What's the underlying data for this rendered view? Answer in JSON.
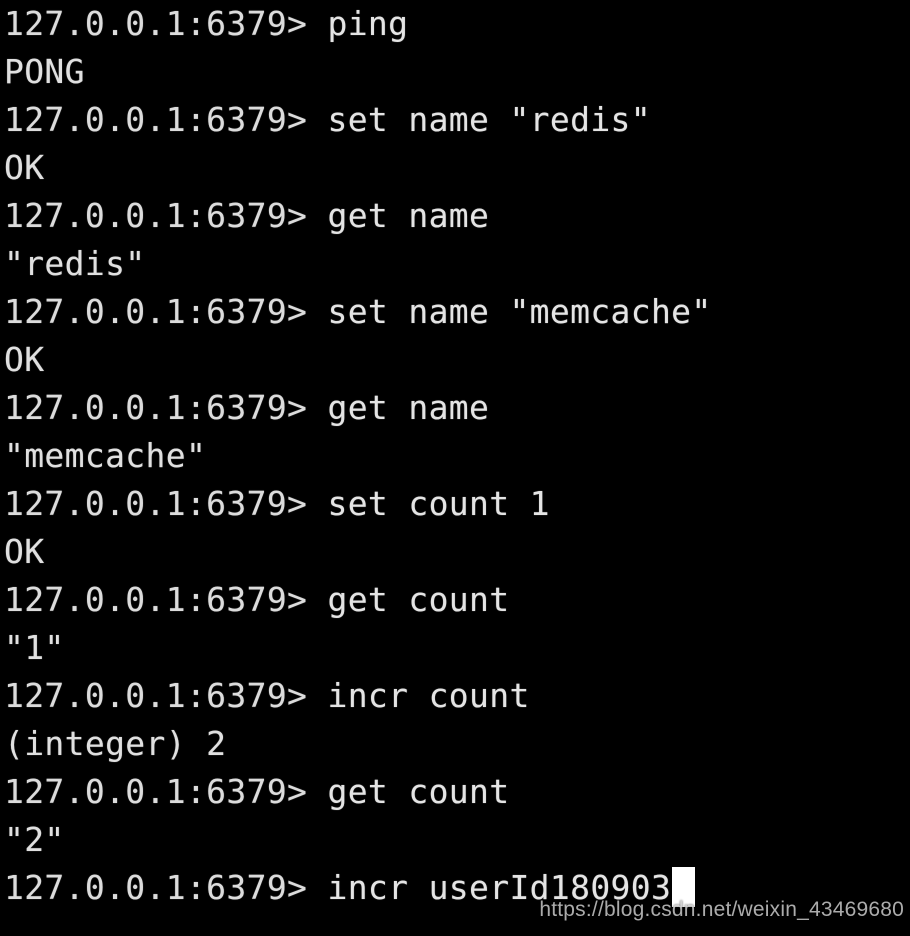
{
  "terminal": {
    "background_color": "#000000",
    "text_color": "#dcdcdc",
    "cursor_color": "#ffffff",
    "prompt": "127.0.0.1:6379>",
    "lines": [
      {
        "type": "command",
        "prompt": "127.0.0.1:6379>",
        "command": " ping"
      },
      {
        "type": "output",
        "text": "PONG"
      },
      {
        "type": "command",
        "prompt": "127.0.0.1:6379>",
        "command": " set name \"redis\""
      },
      {
        "type": "output",
        "text": "OK"
      },
      {
        "type": "command",
        "prompt": "127.0.0.1:6379>",
        "command": " get name"
      },
      {
        "type": "output",
        "text": "\"redis\""
      },
      {
        "type": "command",
        "prompt": "127.0.0.1:6379>",
        "command": " set name \"memcache\""
      },
      {
        "type": "output",
        "text": "OK"
      },
      {
        "type": "command",
        "prompt": "127.0.0.1:6379>",
        "command": " get name"
      },
      {
        "type": "output",
        "text": "\"memcache\""
      },
      {
        "type": "command",
        "prompt": "127.0.0.1:6379>",
        "command": " set count 1"
      },
      {
        "type": "output",
        "text": "OK"
      },
      {
        "type": "command",
        "prompt": "127.0.0.1:6379>",
        "command": " get count"
      },
      {
        "type": "output",
        "text": "\"1\""
      },
      {
        "type": "command",
        "prompt": "127.0.0.1:6379>",
        "command": " incr count"
      },
      {
        "type": "output",
        "text": "(integer) 2"
      },
      {
        "type": "command",
        "prompt": "127.0.0.1:6379>",
        "command": " get count"
      },
      {
        "type": "output",
        "text": "\"2\""
      },
      {
        "type": "active",
        "prompt": "127.0.0.1:6379>",
        "command": " incr userId180903"
      }
    ]
  },
  "watermark": {
    "text": "https://blog.csdn.net/weixin_43469680"
  }
}
